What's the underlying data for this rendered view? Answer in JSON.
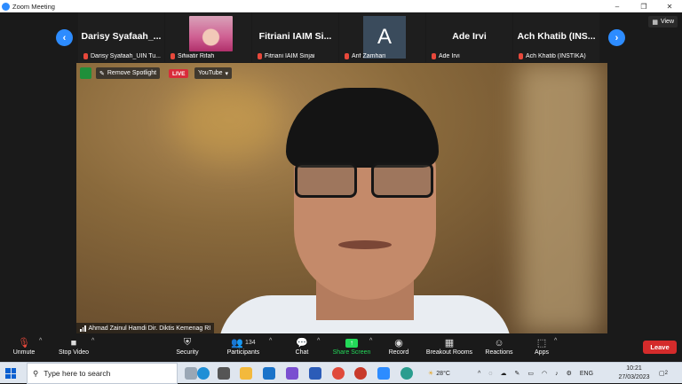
{
  "window": {
    "title": "Zoom Meeting",
    "controls": [
      "–",
      "❐",
      "✕"
    ]
  },
  "gallery": {
    "prev_icon": "chevron-left-icon",
    "next_icon": "chevron-right-icon",
    "view_label": "View",
    "tiles": [
      {
        "big_name": "Darisy  Syafaah_...",
        "label": "Darisy Syafaah_UIN Tu..."
      },
      {
        "big_name": "",
        "label": "Sifwatir Rifah"
      },
      {
        "big_name": "Fitriani  IAIM  Si...",
        "label": "Fitriani IAIM Sinjai"
      },
      {
        "big_name": "A",
        "label": "Arif Zamhari"
      },
      {
        "big_name": "Ade  Irvi",
        "label": "Ade Irvi"
      },
      {
        "big_name": "Ach  Khatib  (INS...",
        "label": "Ach Khatib (INSTIKA)"
      }
    ]
  },
  "video": {
    "remove_spotlight": "Remove Spotlight",
    "live": "LIVE",
    "youtube": "YouTube",
    "speaker_name": "Ahmad Zainul Hamdi Dir. Diktis Kemenag RI"
  },
  "toolbar": {
    "unmute": "Unmute",
    "stop_video": "Stop Video",
    "security": "Security",
    "participants": "Participants",
    "participants_count": "134",
    "chat": "Chat",
    "share_screen": "Share Screen",
    "record": "Record",
    "breakout_rooms": "Breakout Rooms",
    "reactions": "Reactions",
    "apps": "Apps",
    "leave": "Leave"
  },
  "colors": {
    "zoom_blue": "#2d8cff",
    "leave_red": "#d42b2b",
    "share_green": "#23d959",
    "live_red": "#d92c3a"
  },
  "taskbar": {
    "search_placeholder": "Type here to search",
    "weather": "28°C",
    "language": "ENG",
    "time": "10:21",
    "date": "27/03/2023",
    "notifications": "2"
  }
}
